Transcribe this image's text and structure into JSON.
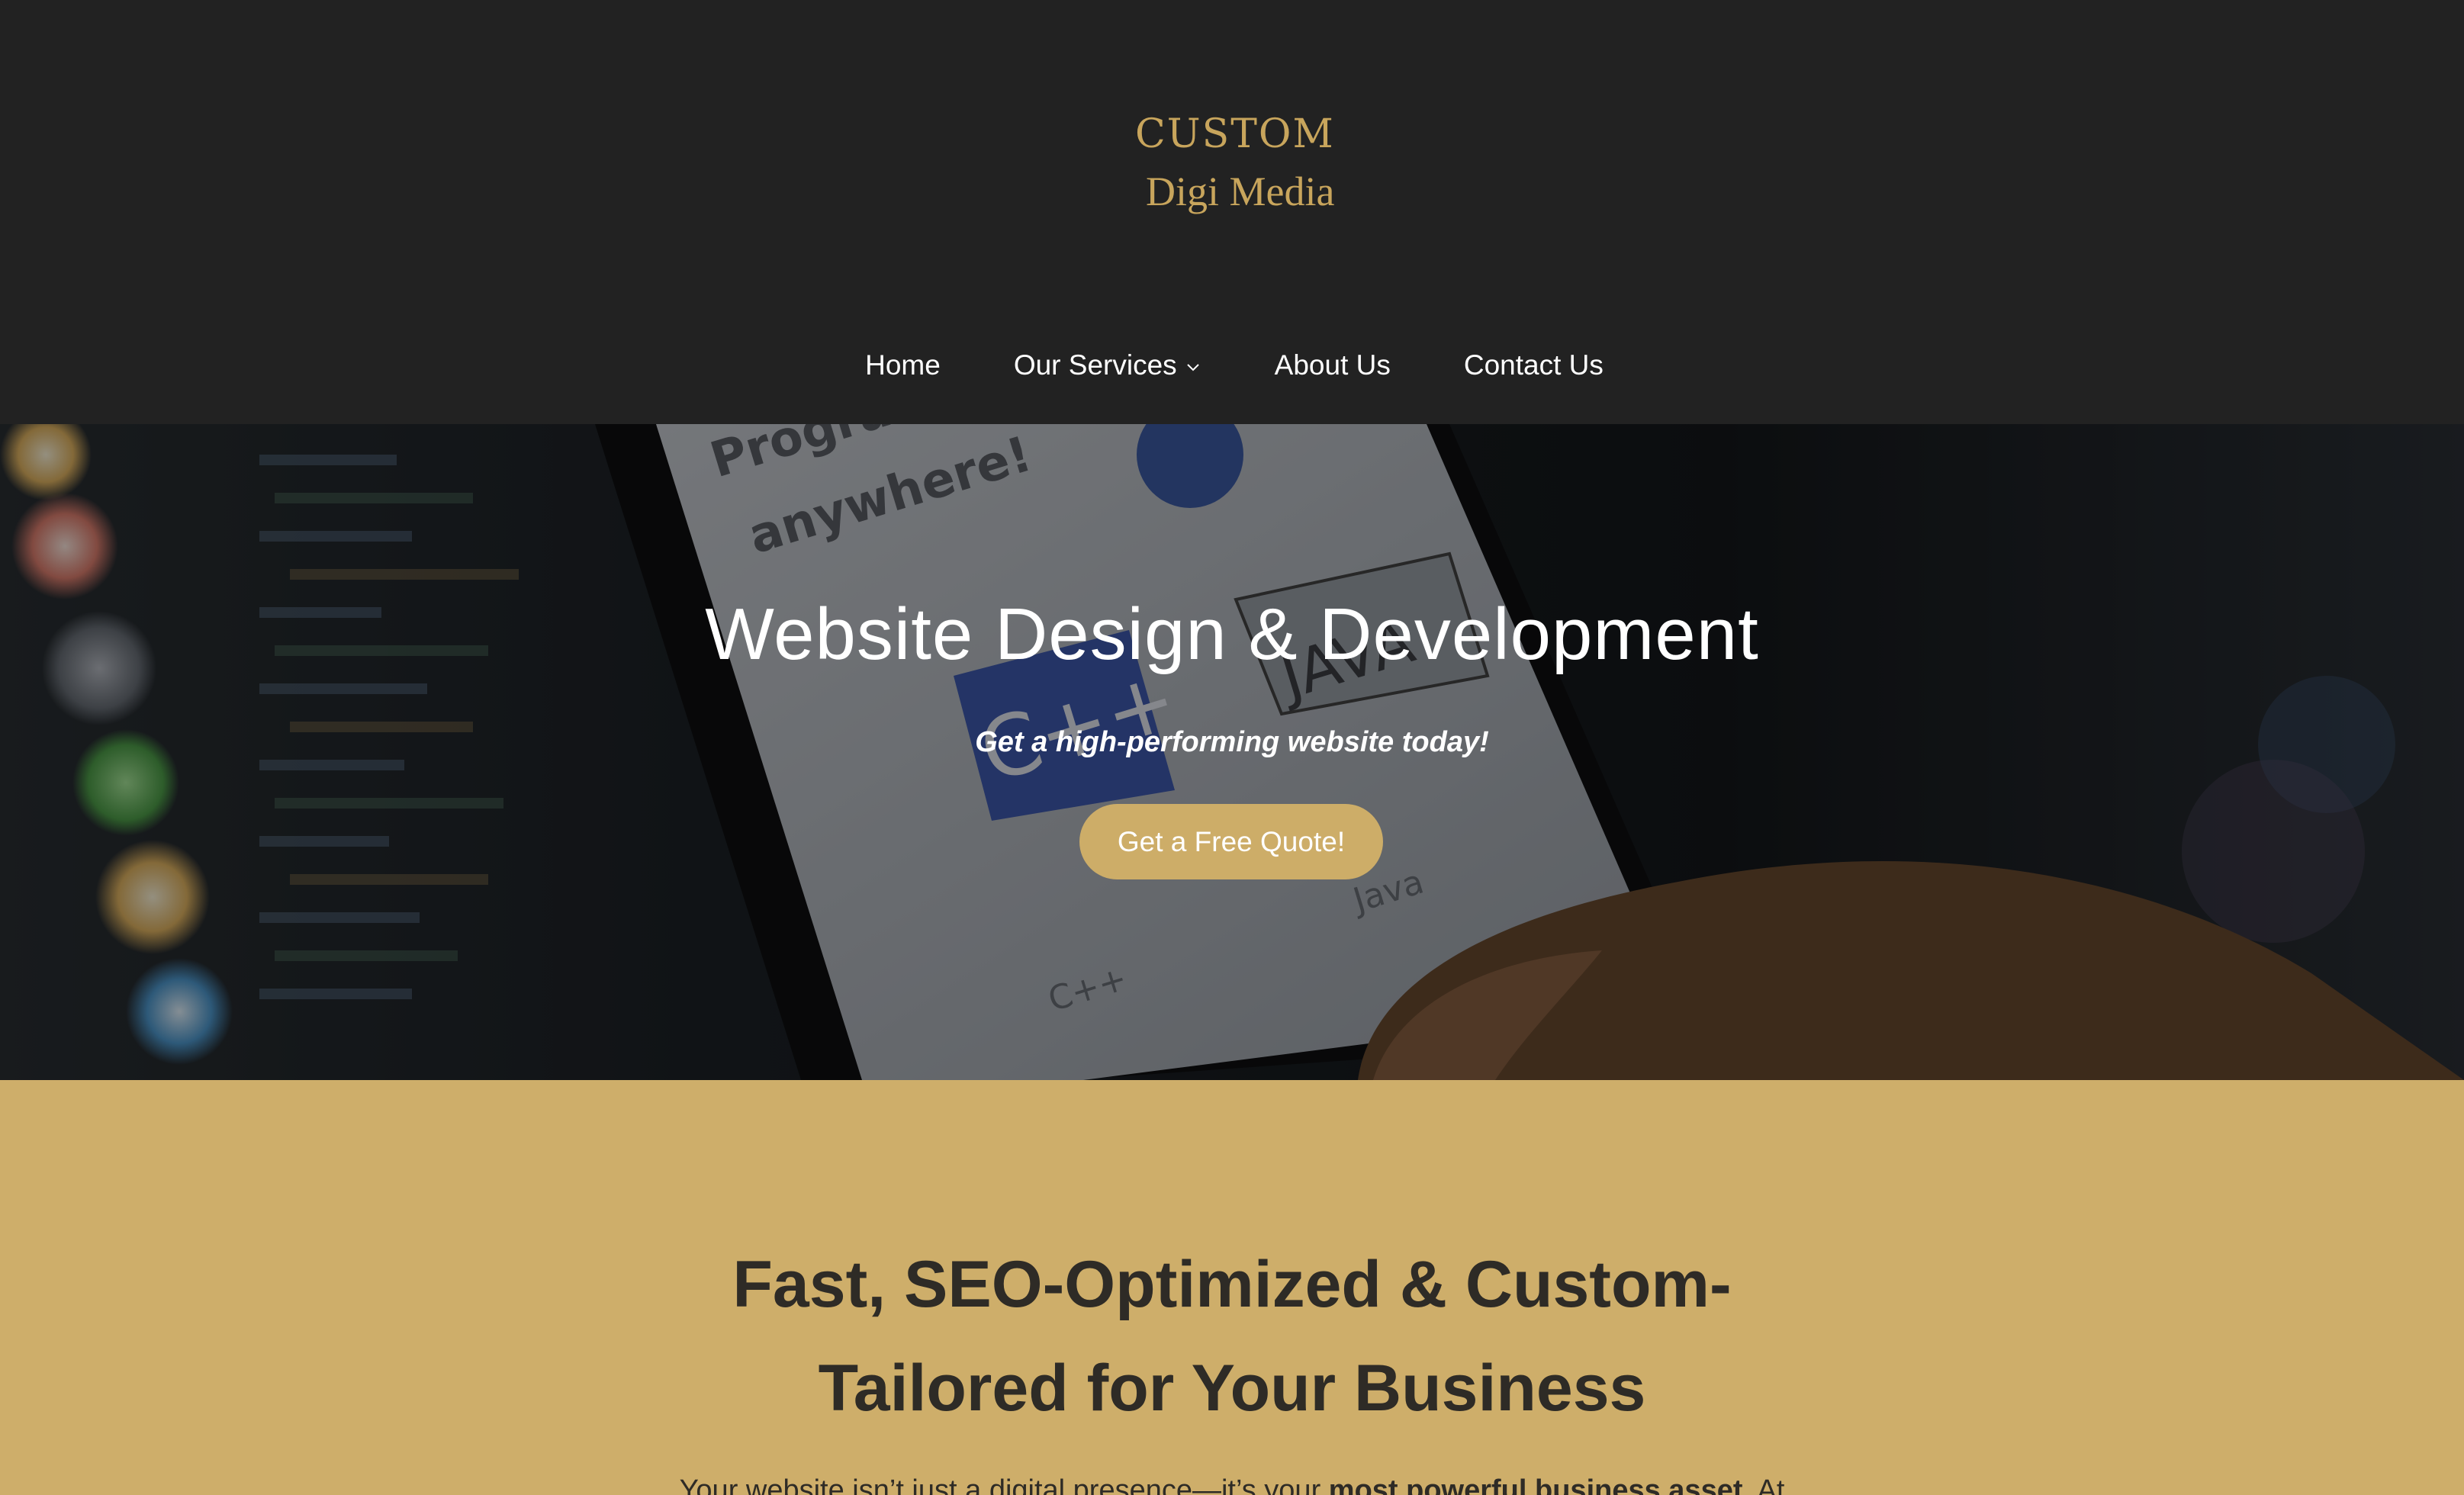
{
  "brand": {
    "logo_line1": "CUSTOM",
    "logo_line2": "Digi Media",
    "logo_color": "#c8a55c"
  },
  "nav": {
    "items": [
      {
        "label": "Home",
        "has_dropdown": false
      },
      {
        "label": "Our Services",
        "has_dropdown": true,
        "icon": "chevron-down-icon"
      },
      {
        "label": "About Us",
        "has_dropdown": false
      },
      {
        "label": "Contact Us",
        "has_dropdown": false
      }
    ]
  },
  "hero": {
    "title": "Website Design & Development",
    "subtitle": "Get a high-performing website today!",
    "cta_label": "Get a Free Quote!",
    "cta_color": "#cdad68",
    "background_image": "hand holding phone with programming app in front of code screen"
  },
  "intro": {
    "heading": "Fast, SEO-Optimized & Custom-Tailored for Your Business",
    "paragraph_start": "Your website isn’t just a digital presence—it’s your ",
    "paragraph_strong": "most powerful business asset",
    "paragraph_end": ". At",
    "background_color": "#ceae6a"
  },
  "colors": {
    "header_bg": "#222222",
    "text_dark": "#2e2b26",
    "white": "#ffffff"
  }
}
